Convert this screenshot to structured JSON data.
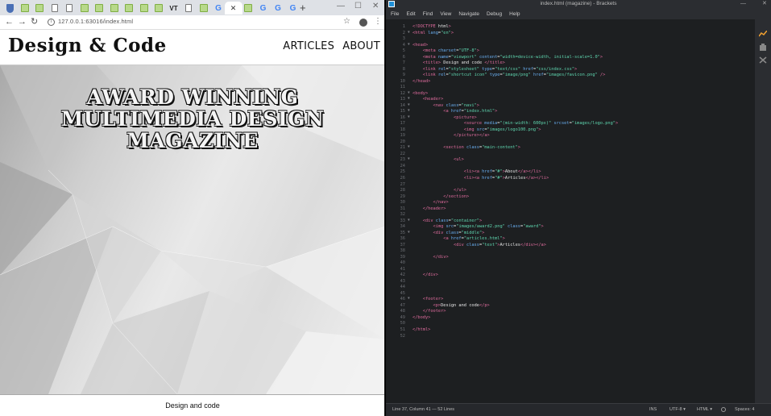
{
  "browser": {
    "tab_icons": [
      "shield",
      "green",
      "green",
      "doc",
      "doc",
      "green",
      "green",
      "green",
      "green",
      "green",
      "green",
      "vt",
      "doc",
      "green",
      "g",
      "active",
      "green",
      "g",
      "g",
      "g"
    ],
    "address": "127.0.0.1:63016/index.html",
    "close_tab_glyph": "✕",
    "new_tab_glyph": "+"
  },
  "site": {
    "logo": "Design & Code",
    "nav": [
      "ARTICLES",
      "ABOUT"
    ],
    "award_lines": [
      "AWARD WINNING",
      "MULTIMEDIA DESIGN",
      "MAGAZINE"
    ],
    "footer": "Design and code"
  },
  "editor": {
    "title": "index.html (magazine) - Brackets",
    "menu": [
      "File",
      "Edit",
      "Find",
      "View",
      "Navigate",
      "Debug",
      "Help"
    ],
    "code_lines": [
      "<!DOCTYPE html>",
      "<html lang=\"en\">",
      "",
      "<head>",
      "    <meta charset=\"UTF-8\">",
      "    <meta name=\"viewport\" content=\"width=device-width, initial-scale=1.0\">",
      "    <title> Design and code </title>",
      "    <link rel=\"stylesheet\" type=\"text/css\" href=\"css/index.css\">",
      "    <link rel=\"shortcut icon\" type=\"image/png\" href=\"images/favicon.png\" />",
      "</head>",
      "",
      "<body>",
      "    <header>",
      "        <nav class=\"navi\">",
      "            <a href=\"index.html\">",
      "                <picture>",
      "                    <source media=\"(min-width: 600px)\" srcset=\"images/logo.png\">",
      "                    <img src=\"images/logo100.png\">",
      "                </picture></a>",
      "",
      "            <section class=\"main-content\">",
      "",
      "                <ul>",
      "",
      "                    <li><a href=\"#\">About</a></li>",
      "                    <li><a href=\"#\">Articles</a></li>",
      "",
      "                </ul>",
      "            </section>",
      "        </nav>",
      "    </header>",
      "",
      "    <div class=\"container\">",
      "        <img src=\"images/award2.png\" class=\"award\">",
      "        <div class=\"middle\">",
      "            <a href=\"articles.html\">",
      "                <div class=\"text\">Articles</div></a>",
      "",
      "        </div>",
      "",
      "",
      "    </div>",
      "",
      "",
      "",
      "    <footer>",
      "        <p>Design and code</p>",
      "    </footer>",
      "</body>",
      "",
      "</html>",
      ""
    ],
    "fold_lines": [
      2,
      4,
      12,
      13,
      14,
      15,
      16,
      21,
      23,
      33,
      35,
      46
    ],
    "status": {
      "position": "Line 37, Column 41 — 52 Lines",
      "mode": "INS",
      "encoding": "UTF-8 ▾",
      "language": "HTML ▾",
      "spaces": "Spaces: 4"
    }
  },
  "colors": {
    "editor_bg": "#1d1f21",
    "tag": "#e06c9e",
    "attr": "#6ab0f3",
    "value": "#5fd7b0"
  }
}
